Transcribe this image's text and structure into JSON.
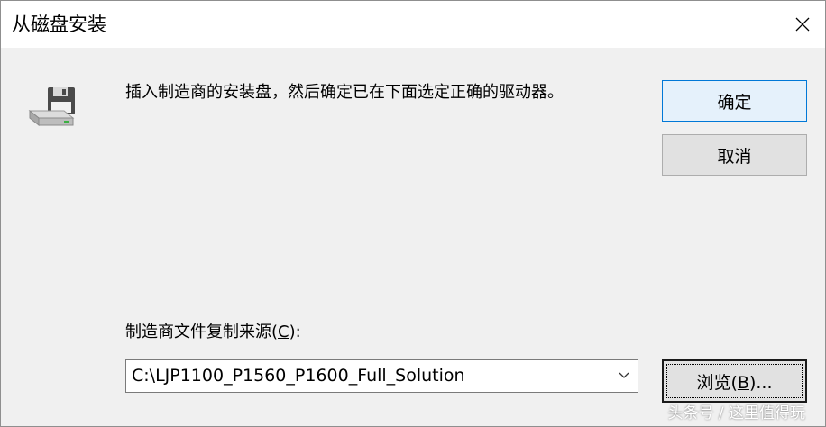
{
  "window": {
    "title": "从磁盘安装",
    "close_icon": "close-icon"
  },
  "body": {
    "icon": "floppy-drive-icon",
    "message": "插入制造商的安装盘，然后确定已在下面选定正确的驱动器。"
  },
  "buttons": {
    "ok_label": "确定",
    "cancel_label": "取消",
    "browse_prefix": "浏览(",
    "browse_accel": "B",
    "browse_suffix": ")..."
  },
  "source": {
    "label_prefix": "制造商文件复制来源(",
    "label_accel": "C",
    "label_suffix": "):",
    "value": "C:\\LJP1100_P1560_P1600_Full_Solution",
    "dropdown_icon": "chevron-down-icon"
  },
  "watermark": "头条号 / 这里值得玩",
  "colors": {
    "default_button_border": "#0078d7",
    "default_button_bg": "#e5f1fb",
    "dialog_bg": "#f0f0f0"
  }
}
